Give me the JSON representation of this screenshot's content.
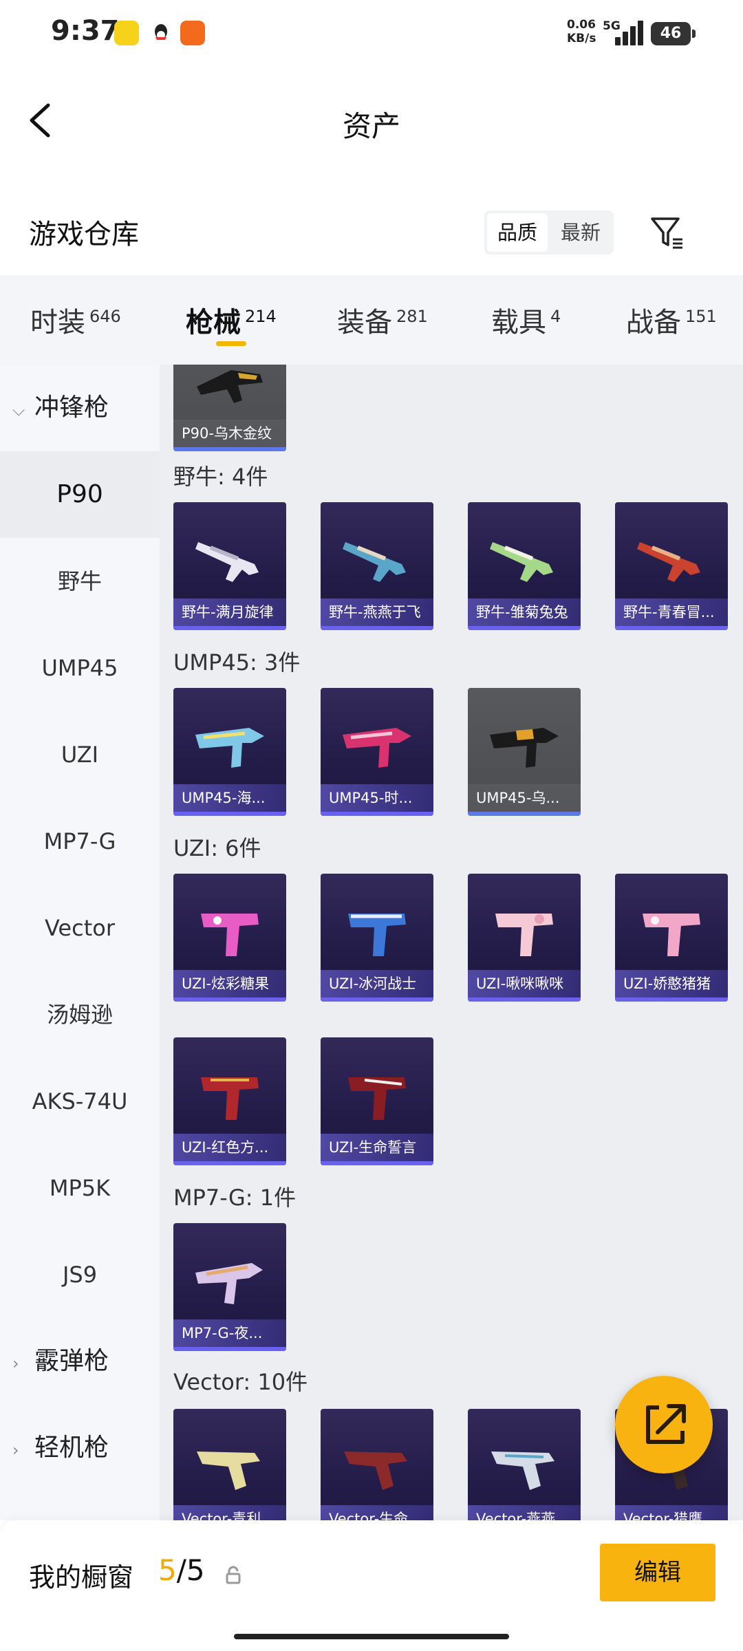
{
  "status_bar": {
    "time": "9:37",
    "net_speed": "0.06",
    "net_unit": "KB/s",
    "network": "5G",
    "battery": "46"
  },
  "header": {
    "title": "资产",
    "back_icon": "chevron-left-icon"
  },
  "section": {
    "title": "游戏仓库",
    "sort_options": [
      "品质",
      "最新"
    ],
    "selected_sort": "品质",
    "filter_icon": "filter-icon"
  },
  "tabs": [
    {
      "label": "时装",
      "count": "646"
    },
    {
      "label": "枪械",
      "count": "214",
      "active": true
    },
    {
      "label": "装备",
      "count": "281"
    },
    {
      "label": "载具",
      "count": "4"
    },
    {
      "label": "战备",
      "count": "151"
    }
  ],
  "sidebar": {
    "group_open": "冲锋枪",
    "items": [
      "P90",
      "野牛",
      "UMP45",
      "UZI",
      "MP7-G",
      "Vector",
      "汤姆逊",
      "AKS-74U",
      "MP5K",
      "JS9"
    ],
    "selected": "P90",
    "groups_collapsed": [
      "霰弹枪",
      "轻机枪"
    ]
  },
  "grid": {
    "top_card": {
      "name": "P90-乌木金纹",
      "quality": "grey"
    },
    "groups": [
      {
        "label": "野牛: 4件",
        "items": [
          {
            "name": "野牛-满月旋律",
            "q": "purple"
          },
          {
            "name": "野牛-燕燕于飞",
            "q": "purple"
          },
          {
            "name": "野牛-雏菊兔兔",
            "q": "purple"
          },
          {
            "name": "野牛-青春冒...",
            "q": "purple"
          }
        ]
      },
      {
        "label": "UMP45: 3件",
        "items": [
          {
            "name": "UMP45-海...",
            "q": "purple"
          },
          {
            "name": "UMP45-时...",
            "q": "purple"
          },
          {
            "name": "UMP45-乌...",
            "q": "grey"
          }
        ]
      },
      {
        "label": "UZI: 6件",
        "items": [
          {
            "name": "UZI-炫彩糖果",
            "q": "purple"
          },
          {
            "name": "UZI-冰河战士",
            "q": "purple"
          },
          {
            "name": "UZI-啾咪啾咪",
            "q": "purple"
          },
          {
            "name": "UZI-娇憨猪猪",
            "q": "purple"
          },
          {
            "name": "UZI-红色方...",
            "q": "purple"
          },
          {
            "name": "UZI-生命誓言",
            "q": "purple"
          }
        ]
      },
      {
        "label": "MP7-G: 1件",
        "items": [
          {
            "name": "MP7-G-夜...",
            "q": "purple"
          }
        ]
      },
      {
        "label": "Vector: 10件",
        "items": [
          {
            "name": "Vector-青利...",
            "q": "purple"
          },
          {
            "name": "Vector-生命...",
            "q": "purple"
          },
          {
            "name": "Vector-燕燕...",
            "q": "purple"
          },
          {
            "name": "Vector-猎鹰...",
            "q": "purple"
          }
        ]
      }
    ]
  },
  "fab": {
    "icon": "share-icon"
  },
  "bottom": {
    "label": "我的橱窗",
    "current": "5",
    "total": "/5",
    "lock_icon": "lock-icon",
    "edit_label": "编辑"
  },
  "colors": {
    "accent": "#f8b310",
    "purple_card": "#2b2352",
    "grey_card": "#505155",
    "card_bar": "#6a62ee"
  }
}
